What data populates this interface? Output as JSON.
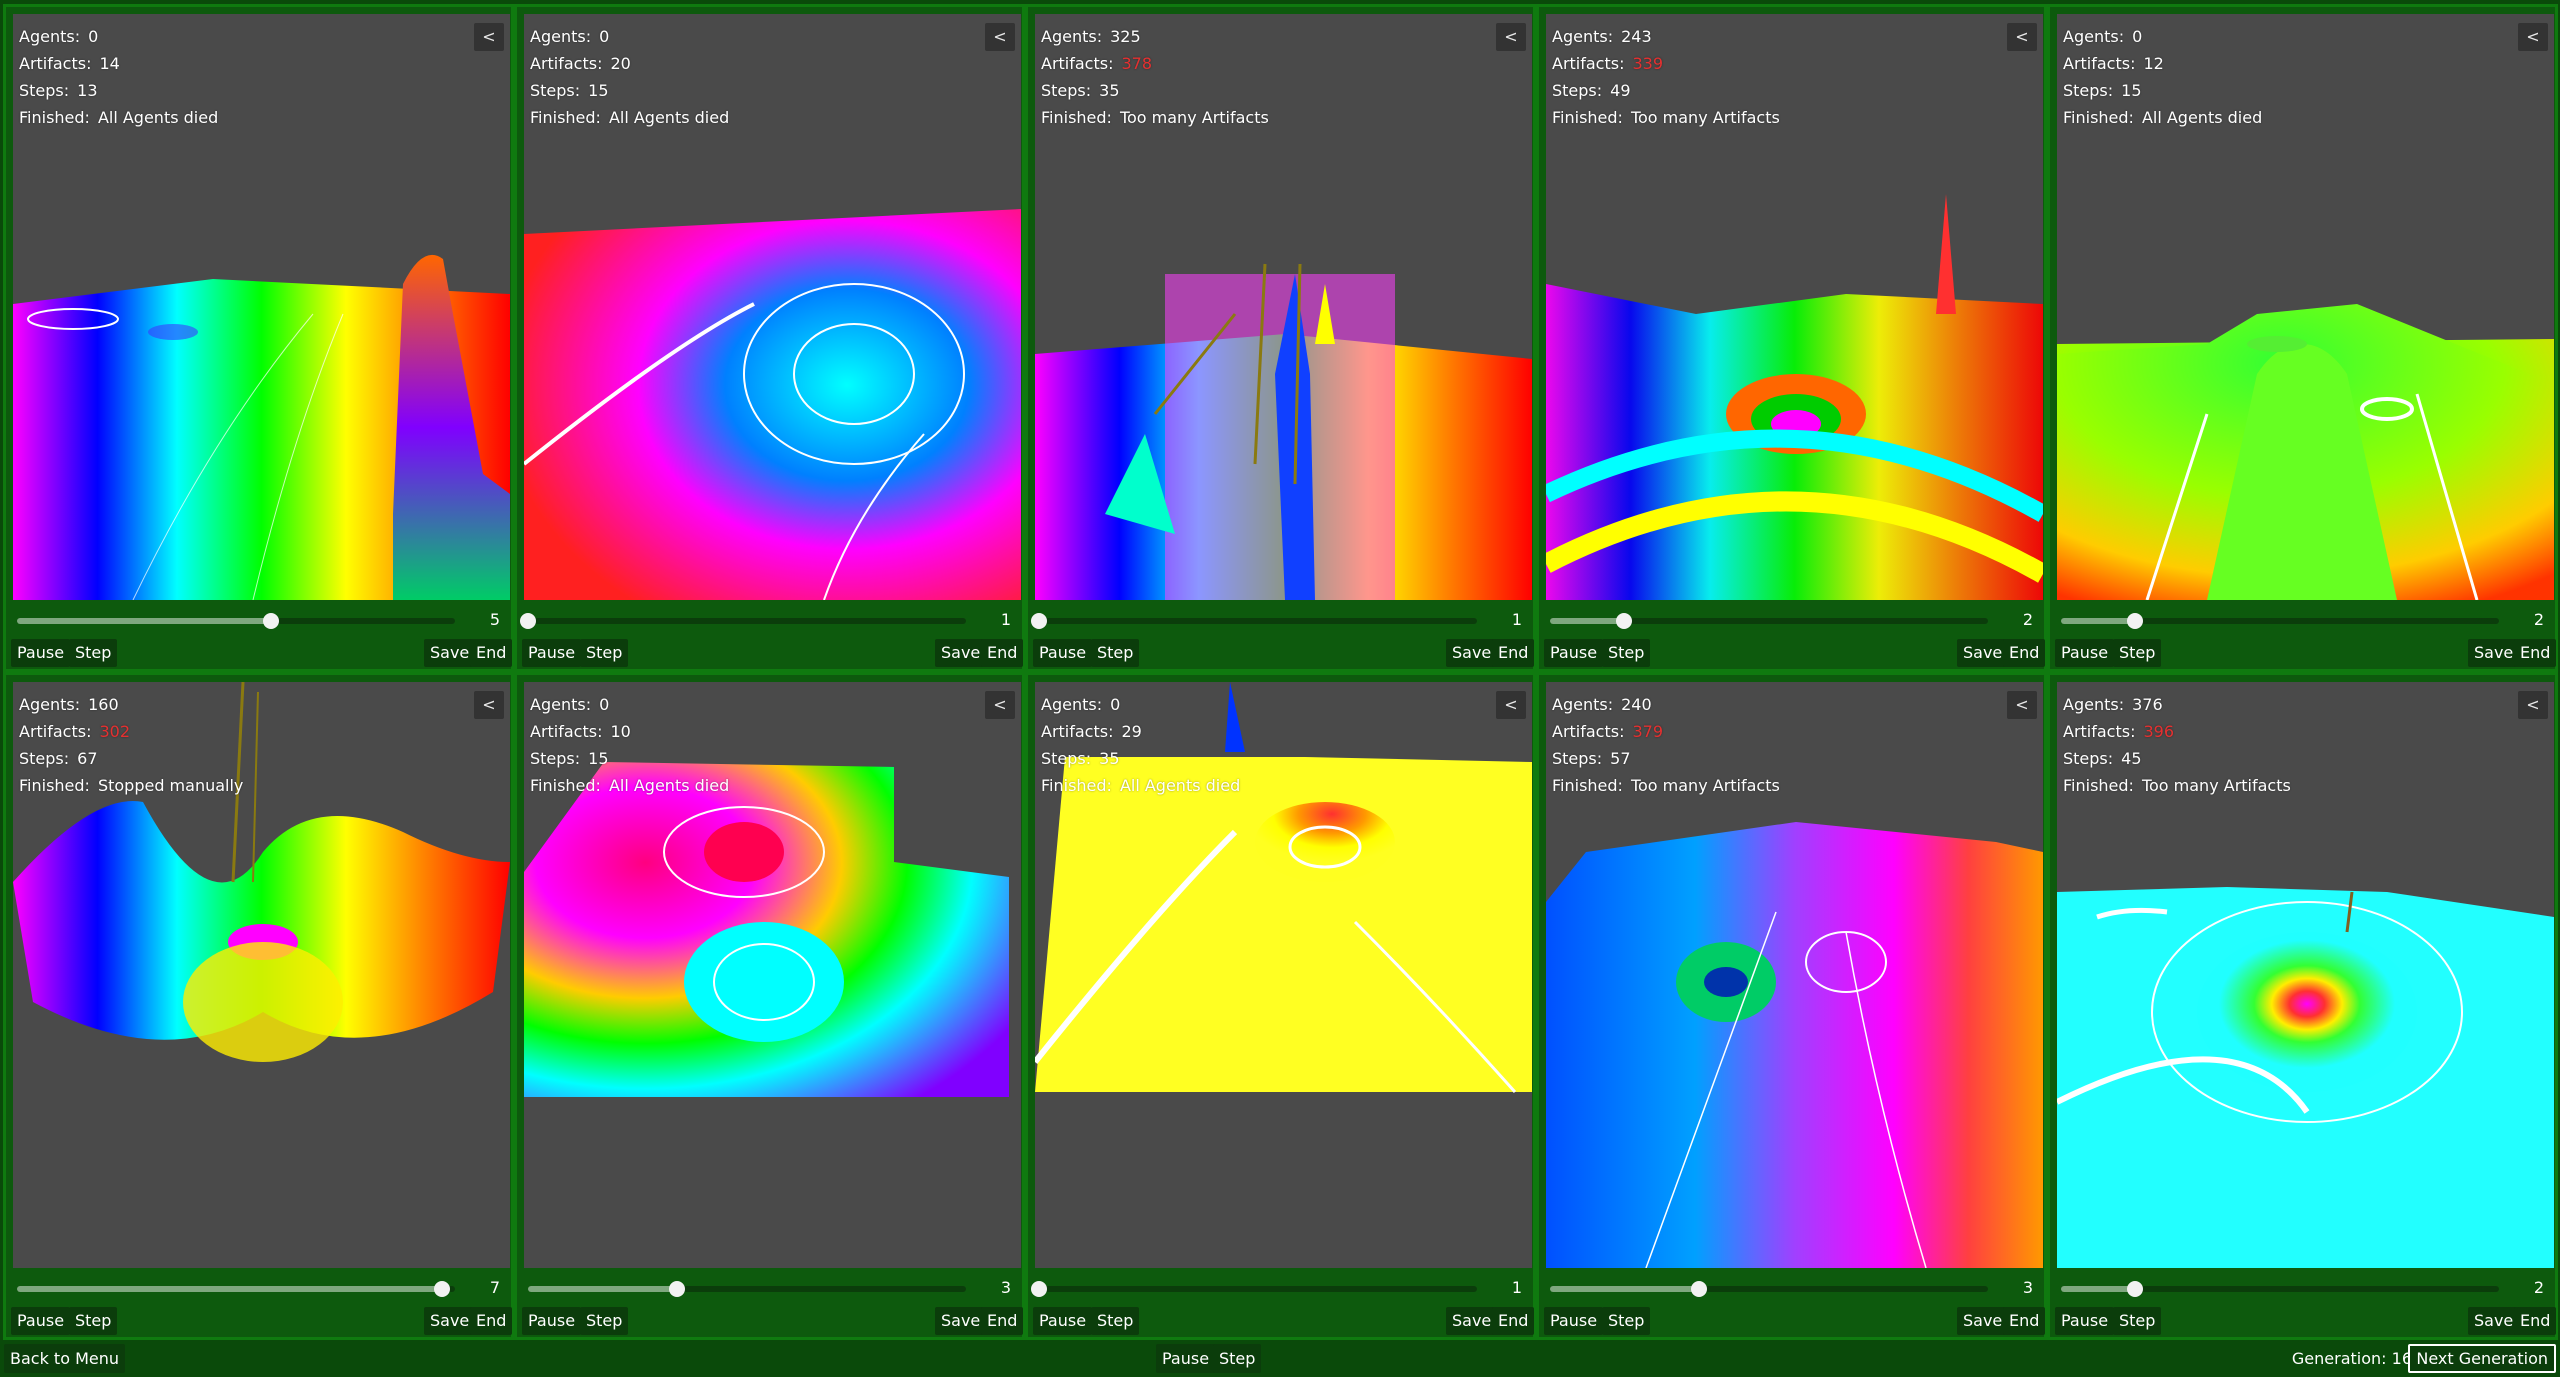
{
  "panels": [
    {
      "agents_label": "Agents:",
      "agents": "0",
      "artifacts_label": "Artifacts:",
      "artifacts": "14",
      "artifacts_red": false,
      "steps_label": "Steps:",
      "steps": "13",
      "finished_label": "Finished:",
      "finished": "All Agents died",
      "collapse": "<",
      "slider_value": "5",
      "slider_fraction": 0.58,
      "pause": "Pause",
      "step": "Step",
      "save": "Save",
      "end": "End"
    },
    {
      "agents_label": "Agents:",
      "agents": "0",
      "artifacts_label": "Artifacts:",
      "artifacts": "20",
      "artifacts_red": false,
      "steps_label": "Steps:",
      "steps": "15",
      "finished_label": "Finished:",
      "finished": "All Agents died",
      "collapse": "<",
      "slider_value": "1",
      "slider_fraction": 0.0,
      "pause": "Pause",
      "step": "Step",
      "save": "Save",
      "end": "End"
    },
    {
      "agents_label": "Agents:",
      "agents": "325",
      "artifacts_label": "Artifacts:",
      "artifacts": "378",
      "artifacts_red": true,
      "steps_label": "Steps:",
      "steps": "35",
      "finished_label": "Finished:",
      "finished": "Too many Artifacts",
      "collapse": "<",
      "slider_value": "1",
      "slider_fraction": 0.0,
      "pause": "Pause",
      "step": "Step",
      "save": "Save",
      "end": "End"
    },
    {
      "agents_label": "Agents:",
      "agents": "243",
      "artifacts_label": "Artifacts:",
      "artifacts": "339",
      "artifacts_red": true,
      "steps_label": "Steps:",
      "steps": "49",
      "finished_label": "Finished:",
      "finished": "Too many Artifacts",
      "collapse": "<",
      "slider_value": "2",
      "slider_fraction": 0.17,
      "pause": "Pause",
      "step": "Step",
      "save": "Save",
      "end": "End"
    },
    {
      "agents_label": "Agents:",
      "agents": "0",
      "artifacts_label": "Artifacts:",
      "artifacts": "12",
      "artifacts_red": false,
      "steps_label": "Steps:",
      "steps": "15",
      "finished_label": "Finished:",
      "finished": "All Agents died",
      "collapse": "<",
      "slider_value": "2",
      "slider_fraction": 0.17,
      "pause": "Pause",
      "step": "Step",
      "save": "Save",
      "end": "End"
    },
    {
      "agents_label": "Agents:",
      "agents": "160",
      "artifacts_label": "Artifacts:",
      "artifacts": "302",
      "artifacts_red": true,
      "steps_label": "Steps:",
      "steps": "67",
      "finished_label": "Finished:",
      "finished": "Stopped manually",
      "collapse": "<",
      "slider_value": "7",
      "slider_fraction": 0.97,
      "pause": "Pause",
      "step": "Step",
      "save": "Save",
      "end": "End"
    },
    {
      "agents_label": "Agents:",
      "agents": "0",
      "artifacts_label": "Artifacts:",
      "artifacts": "10",
      "artifacts_red": false,
      "steps_label": "Steps:",
      "steps": "15",
      "finished_label": "Finished:",
      "finished": "All Agents died",
      "collapse": "<",
      "slider_value": "3",
      "slider_fraction": 0.34,
      "pause": "Pause",
      "step": "Step",
      "save": "Save",
      "end": "End"
    },
    {
      "agents_label": "Agents:",
      "agents": "0",
      "artifacts_label": "Artifacts:",
      "artifacts": "29",
      "artifacts_red": false,
      "steps_label": "Steps:",
      "steps": "35",
      "finished_label": "Finished:",
      "finished": "All Agents died",
      "collapse": "<",
      "slider_value": "1",
      "slider_fraction": 0.0,
      "pause": "Pause",
      "step": "Step",
      "save": "Save",
      "end": "End"
    },
    {
      "agents_label": "Agents:",
      "agents": "240",
      "artifacts_label": "Artifacts:",
      "artifacts": "379",
      "artifacts_red": true,
      "steps_label": "Steps:",
      "steps": "57",
      "finished_label": "Finished:",
      "finished": "Too many Artifacts",
      "collapse": "<",
      "slider_value": "3",
      "slider_fraction": 0.34,
      "pause": "Pause",
      "step": "Step",
      "save": "Save",
      "end": "End"
    },
    {
      "agents_label": "Agents:",
      "agents": "376",
      "artifacts_label": "Artifacts:",
      "artifacts": "396",
      "artifacts_red": true,
      "steps_label": "Steps:",
      "steps": "45",
      "finished_label": "Finished:",
      "finished": "Too many Artifacts",
      "collapse": "<",
      "slider_value": "2",
      "slider_fraction": 0.17,
      "pause": "Pause",
      "step": "Step",
      "save": "Save",
      "end": "End"
    }
  ],
  "footer": {
    "back": "Back to Menu",
    "pause": "Pause",
    "step": "Step",
    "generation_label": "Generation: 16",
    "next": "Next Generation"
  },
  "colors": {
    "background": "#0a4a0a",
    "panel": "#0d5a0d",
    "panel_border": "#0f7a0f",
    "viewport": "#4a4a4a",
    "button": "#0b3d0b",
    "red_value": "#e53030"
  }
}
